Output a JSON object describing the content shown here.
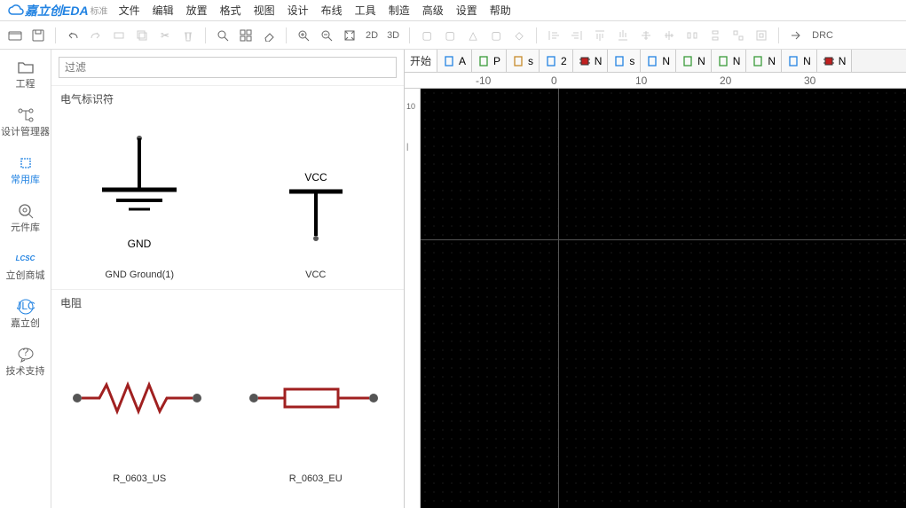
{
  "logo": {
    "brand": "嘉立创EDA",
    "suffix": "标准"
  },
  "menu": [
    "文件",
    "编辑",
    "放置",
    "格式",
    "视图",
    "设计",
    "布线",
    "工具",
    "制造",
    "高级",
    "设置",
    "帮助"
  ],
  "toolbar": {
    "view2d": "2D",
    "view3d": "3D",
    "drc": "DRC"
  },
  "sidebar": [
    {
      "id": "project",
      "label": "工程"
    },
    {
      "id": "design-mgr",
      "label": "设计管理器"
    },
    {
      "id": "common-lib",
      "label": "常用库"
    },
    {
      "id": "parts-lib",
      "label": "元件库"
    },
    {
      "id": "lcsc",
      "label": "立创商城",
      "badge": "LCSC"
    },
    {
      "id": "jlc",
      "label": "嘉立创",
      "badge": "JLC"
    },
    {
      "id": "support",
      "label": "技术支持"
    }
  ],
  "filter": {
    "placeholder": "过滤"
  },
  "groups": [
    {
      "title": "电气标识符",
      "items": [
        {
          "name": "GND Ground(1)",
          "symbol": "GND"
        },
        {
          "name": "VCC",
          "symbol": "VCC"
        }
      ]
    },
    {
      "title": "电阻",
      "items": [
        {
          "name": "R_0603_US",
          "symbol": "R_US"
        },
        {
          "name": "R_0603_EU",
          "symbol": "R_EU"
        }
      ]
    }
  ],
  "tabs": {
    "start": "开始",
    "items": [
      {
        "label": "A",
        "color": "#2283e2"
      },
      {
        "label": "P",
        "color": "#3a9b3a"
      },
      {
        "label": "s",
        "color": "#c78a2a"
      },
      {
        "label": "2",
        "color": "#2283e2"
      },
      {
        "label": "N",
        "color": "#c02020",
        "chip": true
      },
      {
        "label": "s",
        "color": "#2283e2"
      },
      {
        "label": "N",
        "color": "#2283e2"
      },
      {
        "label": "N",
        "color": "#3a9b3a"
      },
      {
        "label": "N",
        "color": "#3a9b3a"
      },
      {
        "label": "N",
        "color": "#3a9b3a"
      },
      {
        "label": "N",
        "color": "#2283e2"
      },
      {
        "label": "N",
        "color": "#c02020",
        "chip": true
      }
    ]
  },
  "ruler_h": [
    {
      "pos": 80,
      "label": "-10"
    },
    {
      "pos": 165,
      "label": "0"
    },
    {
      "pos": 260,
      "label": "10"
    },
    {
      "pos": 355,
      "label": "20"
    },
    {
      "pos": 450,
      "label": "30"
    }
  ],
  "ruler_v": [
    {
      "pos": 15,
      "label": "10"
    },
    {
      "pos": 60,
      "label": "|"
    }
  ]
}
